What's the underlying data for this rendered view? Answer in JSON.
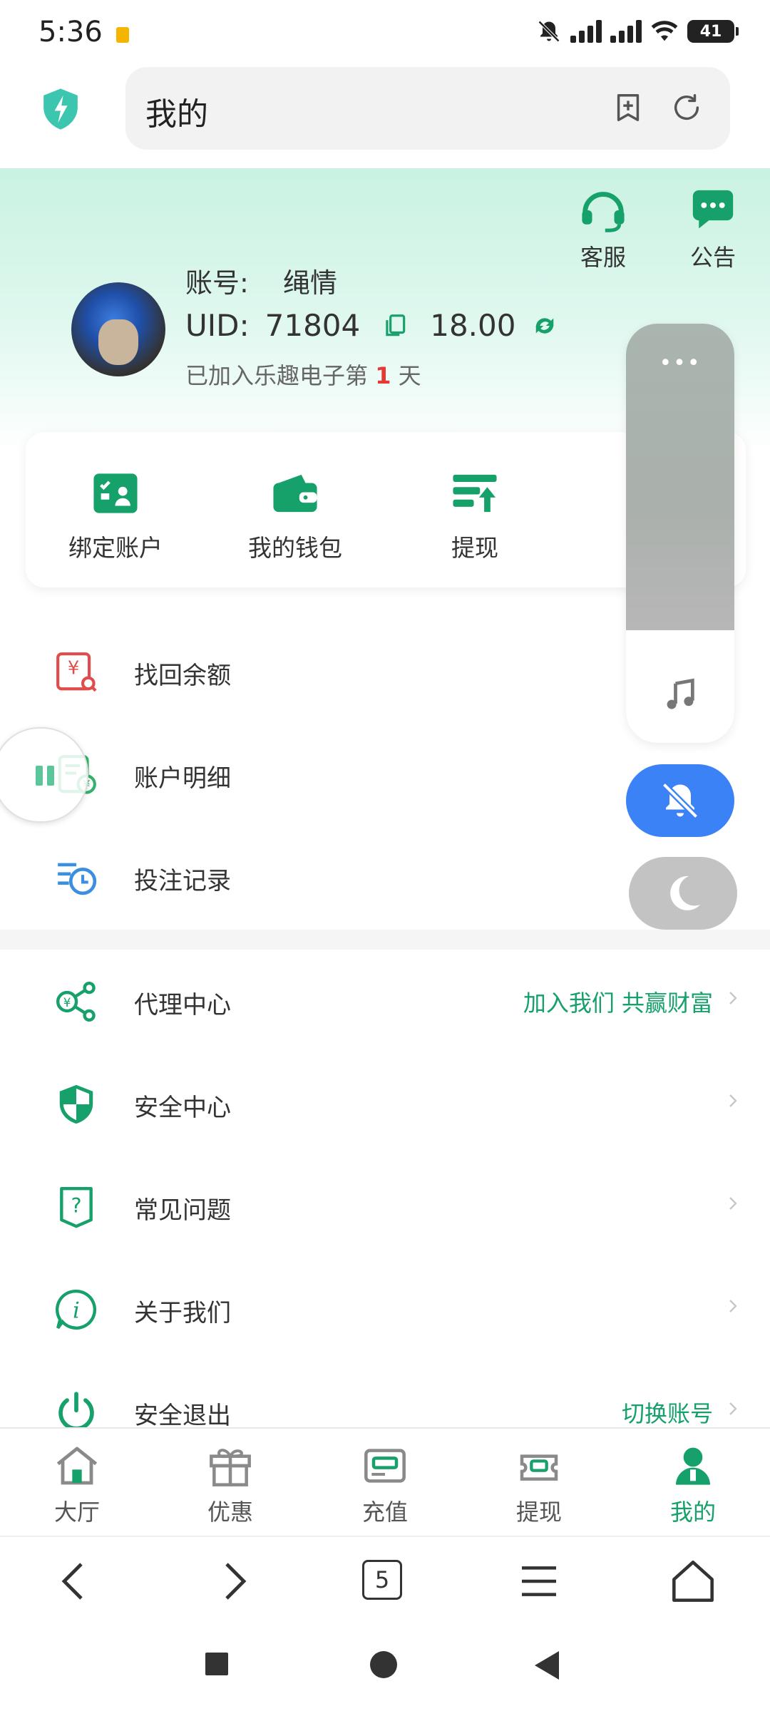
{
  "status_bar": {
    "time": "5:36",
    "battery": "41"
  },
  "browser": {
    "address_text": "我的"
  },
  "header": {
    "customer_service_label": "客服",
    "notice_label": "公告",
    "account_label": "账号:",
    "account_name": "绳情",
    "uid_label": "UID:",
    "uid_value": "71804",
    "balance": "18.00",
    "joined_prefix": "已加入乐趣电子第",
    "joined_days": "1",
    "joined_suffix": "天"
  },
  "quick_actions": [
    {
      "label": "绑定账户",
      "icon": "bind-account-icon"
    },
    {
      "label": "我的钱包",
      "icon": "wallet-icon"
    },
    {
      "label": "提现",
      "icon": "withdraw-icon"
    }
  ],
  "menu_group1": [
    {
      "label": "找回余额",
      "icon": "recover-balance-icon"
    },
    {
      "label": "账户明细",
      "icon": "account-details-icon"
    },
    {
      "label": "投注记录",
      "icon": "bet-record-icon"
    }
  ],
  "menu_group2": [
    {
      "label": "代理中心",
      "extra": "加入我们 共赢财富",
      "icon": "agent-center-icon"
    },
    {
      "label": "安全中心",
      "extra": "",
      "icon": "security-center-icon"
    },
    {
      "label": "常见问题",
      "extra": "",
      "icon": "faq-icon"
    },
    {
      "label": "关于我们",
      "extra": "",
      "icon": "about-us-icon"
    },
    {
      "label": "安全退出",
      "extra": "切换账号",
      "icon": "logout-icon"
    }
  ],
  "floating": {
    "media_dots": "•••"
  },
  "tabbar": [
    {
      "label": "大厅",
      "active": false
    },
    {
      "label": "优惠",
      "active": false
    },
    {
      "label": "充值",
      "active": false
    },
    {
      "label": "提现",
      "active": false
    },
    {
      "label": "我的",
      "active": true
    }
  ],
  "browser_nav": {
    "tab_count": "5"
  },
  "colors": {
    "accent": "#16a06a",
    "header_mint": "#c9f2e2",
    "alert_red": "#e53935",
    "mute_blue": "#3b82f6"
  }
}
